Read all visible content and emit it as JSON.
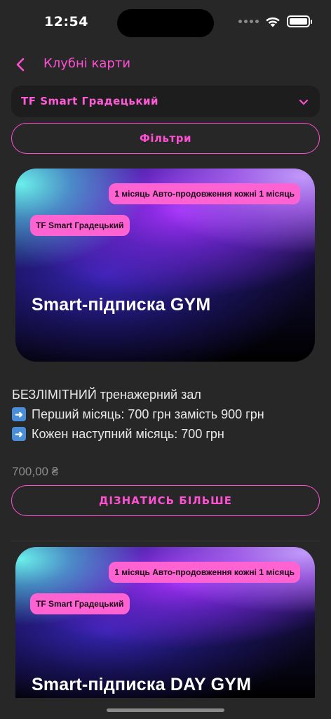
{
  "status_bar": {
    "time": "12:54"
  },
  "nav": {
    "title": "Клубні карти"
  },
  "club_selector": {
    "value": "TF Smart Градецький"
  },
  "filters": {
    "label": "Фільтри"
  },
  "cards": [
    {
      "period_tag": "1 місяць Авто-продовження кожні 1 місяць",
      "club_tag": "TF Smart Градецький",
      "title": "Smart-підписка GYM",
      "description": [
        "БЕЗЛІМІТНИЙ тренажерний зал",
        "Перший місяць: 700 грн замість 900 грн",
        "Кожен наступний місяць: 700 грн"
      ],
      "price": "700,00 ₴",
      "button_label": "ДІЗНАТИСЬ БІЛЬШЕ"
    },
    {
      "period_tag": "1 місяць Авто-продовження кожні 1 місяць",
      "club_tag": "TF Smart Градецький",
      "title": "Smart-підписка DAY GYM"
    }
  ],
  "icons": {
    "back": "chevron-left-icon",
    "dropdown": "chevron-down-icon",
    "bullet": "right-arrow-emoji-icon"
  },
  "colors": {
    "accent": "#ff4fd2",
    "tag_bg": "#ff63d2",
    "background": "#272727"
  }
}
